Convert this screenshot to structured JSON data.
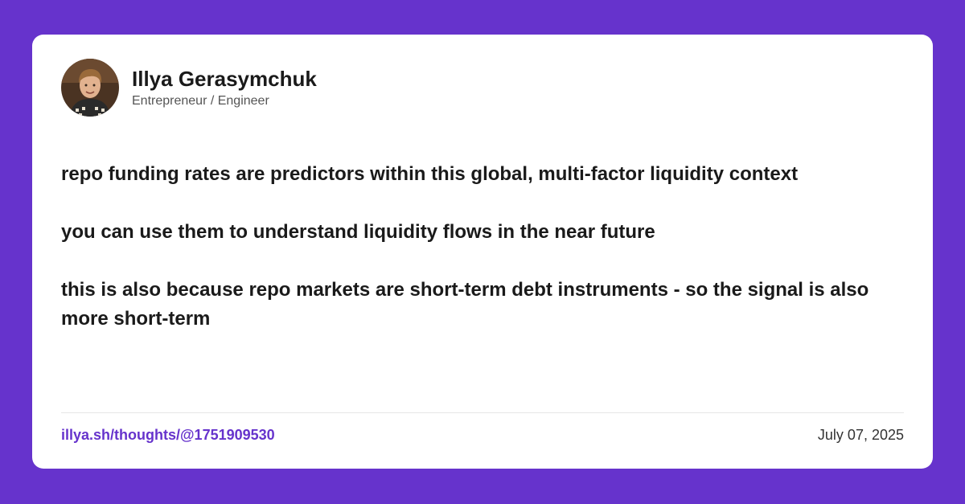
{
  "theme": {
    "background": "#6633CC",
    "card": "#FFFFFF",
    "link_color": "#6633CC",
    "text_color": "#1A1A1A"
  },
  "author": {
    "name": "Illya Gerasymchuk",
    "title": "Entrepreneur / Engineer",
    "avatar_icon": "profile-photo"
  },
  "post": {
    "paragraphs": [
      "repo funding rates are predictors within this global, multi-factor liquidity context",
      "you can use them to understand liquidity flows in the near future",
      "this is also because repo markets are short-term debt instruments - so the signal is also more short-term"
    ]
  },
  "footer": {
    "link": "illya.sh/thoughts/@1751909530",
    "date": "July 07, 2025"
  }
}
